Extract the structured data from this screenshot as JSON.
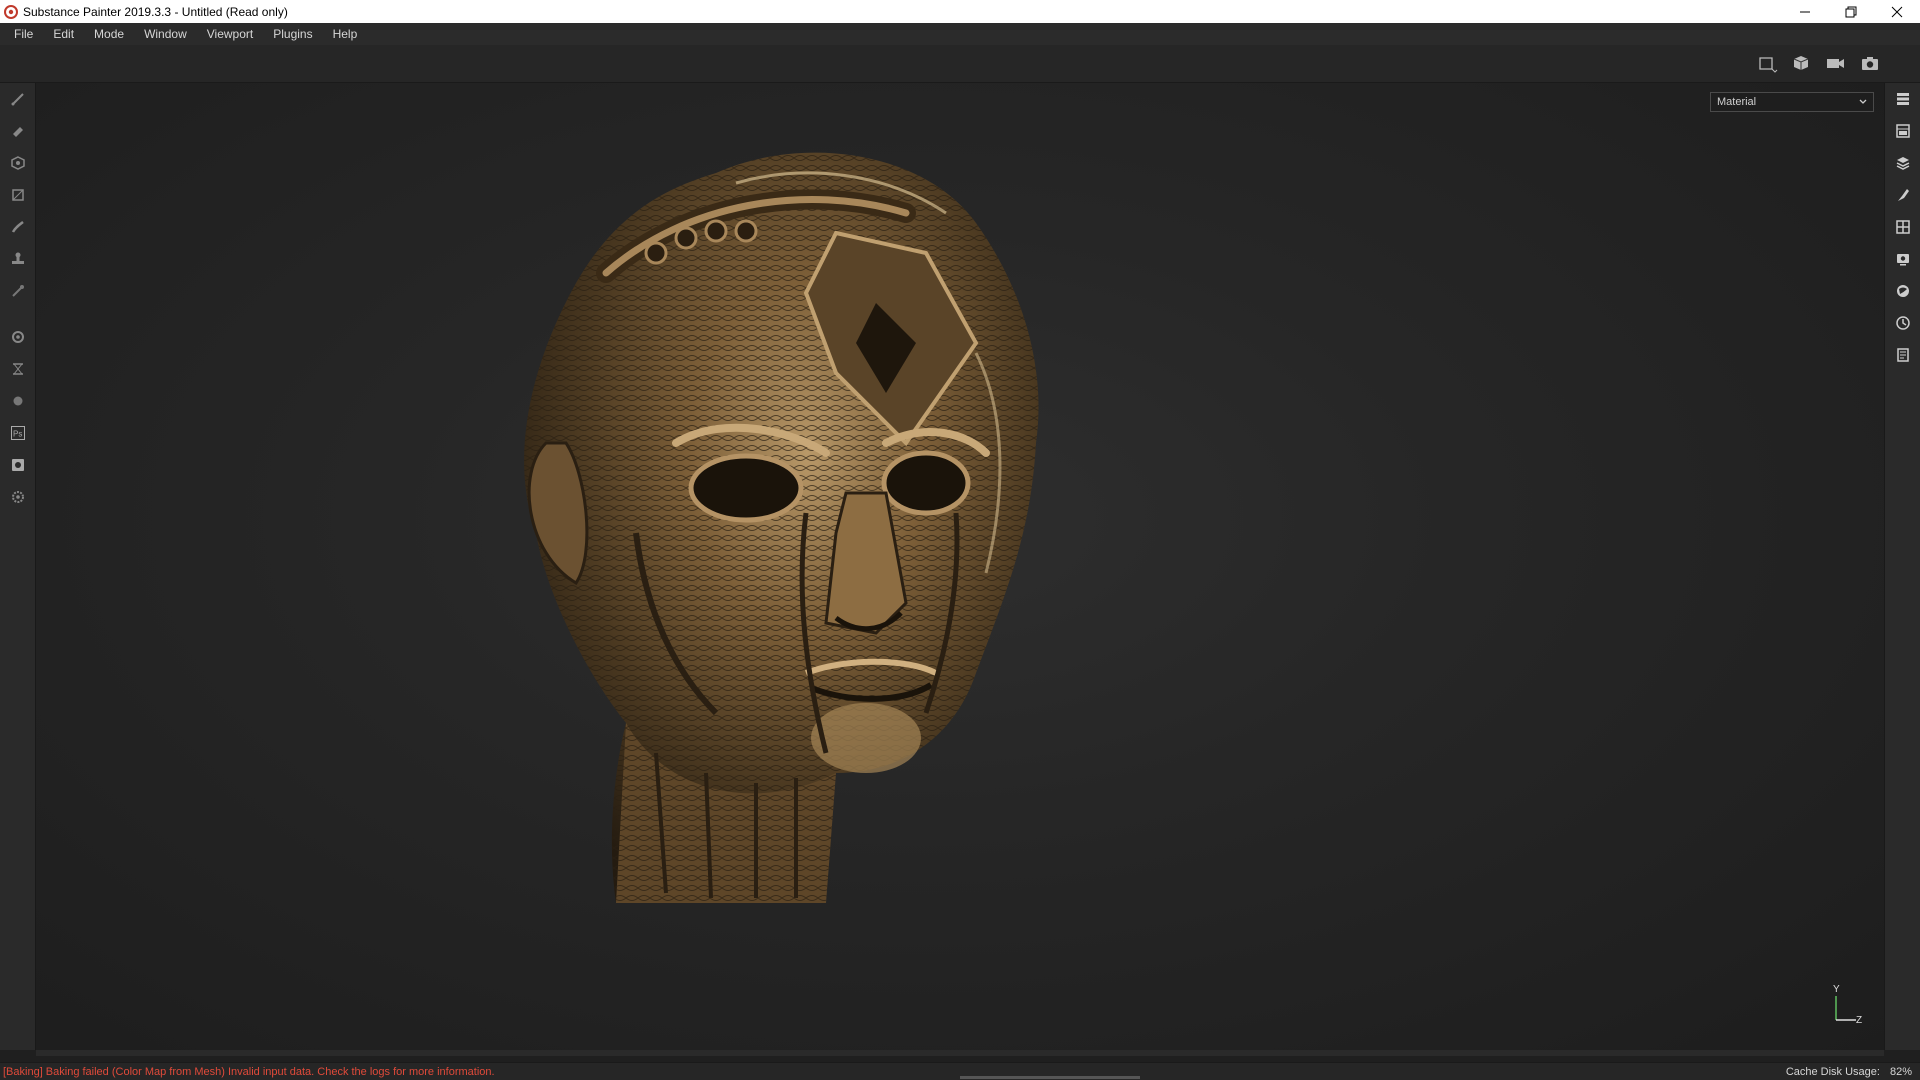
{
  "window": {
    "title": "Substance Painter 2019.3.3 - Untitled (Read only)",
    "controls": [
      "minimize-icon",
      "restore-icon",
      "close-icon"
    ]
  },
  "menu": {
    "items": [
      "File",
      "Edit",
      "Mode",
      "Window",
      "Viewport",
      "Plugins",
      "Help"
    ]
  },
  "toolbar": {
    "right_tools": [
      "2d-view-icon",
      "3d-view-icon",
      "camera-icon",
      "screenshot-icon"
    ]
  },
  "left_tools": [
    "brush-icon",
    "eraser-icon",
    "projection-icon",
    "geometry-fill-icon",
    "smudge-icon",
    "clone-icon",
    "color-picker-icon",
    "bake-settings-icon",
    "iray-icon",
    "sphere-icon",
    "photoshop-export-icon",
    "export-icon",
    "settings-icon"
  ],
  "right_dock": [
    "layers-stack-icon",
    "texture-set-list-icon",
    "layer-icon",
    "brush-properties-icon",
    "uv-grid-icon",
    "display-settings-icon",
    "shader-settings-icon",
    "history-icon",
    "log-icon"
  ],
  "viewport": {
    "channel_select": "Material",
    "gizmo": {
      "y_label": "Y",
      "z_label": "Z"
    }
  },
  "status": {
    "message": "[Baking] Baking failed (Color Map from Mesh) Invalid input data. Check the logs for more information.",
    "cache_label": "Cache Disk Usage:",
    "cache_value": "82%"
  },
  "colors": {
    "error": "#e04a3a",
    "background": "#1f1f1f",
    "bronze": "#8a6a3e"
  }
}
